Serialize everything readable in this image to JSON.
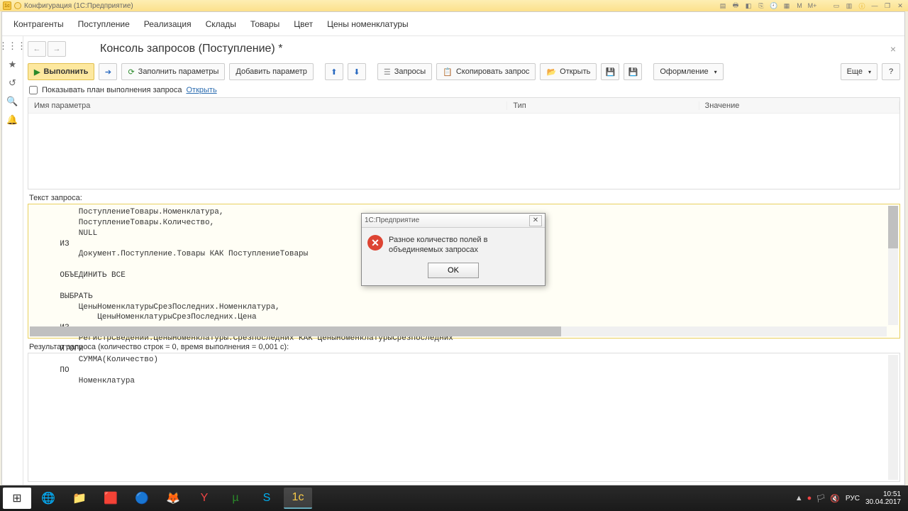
{
  "titlebar": {
    "label": "Конфигурация (1С:Предприятие)"
  },
  "mainmenu": [
    "Контрагенты",
    "Поступление",
    "Реализация",
    "Склады",
    "Товары",
    "Цвет",
    "Цены номенклатуры"
  ],
  "page": {
    "title": "Консоль запросов (Поступление) *"
  },
  "toolbar": {
    "execute": "Выполнить",
    "fill_params": "Заполнить параметры",
    "add_param": "Добавить параметр",
    "queries": "Запросы",
    "copy_query": "Скопировать запрос",
    "open": "Открыть",
    "layout": "Оформление",
    "more": "Еще"
  },
  "checkbox": {
    "label": "Показывать план выполнения запроса",
    "link": "Открыть"
  },
  "params_header": {
    "name": "Имя параметра",
    "type": "Тип",
    "value": "Значение"
  },
  "sections": {
    "query_label": "Текст запроса:",
    "result_label": "Результат запроса (количество строк = 0, время выполнения = 0,001 с):"
  },
  "query_text": "        ПоступлениеТовары.Номенклатура,\n        ПоступлениеТовары.Количество,\n        NULL\n    ИЗ\n        Документ.Поступление.Товары КАК ПоступлениеТовары\n    \n    ОБЪЕДИНИТЬ ВСЕ\n    \n    ВЫБРАТЬ\n        ЦеныНоменклатурыСрезПоследних.Номенклатура,\n            ЦеныНоменклатурыСрезПоследних.Цена\n    ИЗ\n        РегистрСведений.ЦеныНоменклатуры.СрезПоследних КАК ЦеныНоменклатурыСрезПоследних\n    ИТОГИ\n        СУММА(Количество)\n    ПО\n        Номенклатура",
  "dialog": {
    "title": "1С:Предприятие",
    "message": "Разное количество полей в объединяемых запросах",
    "ok": "OK"
  },
  "tray": {
    "lang": "РУС",
    "time": "10:51",
    "date": "30.04.2017"
  }
}
